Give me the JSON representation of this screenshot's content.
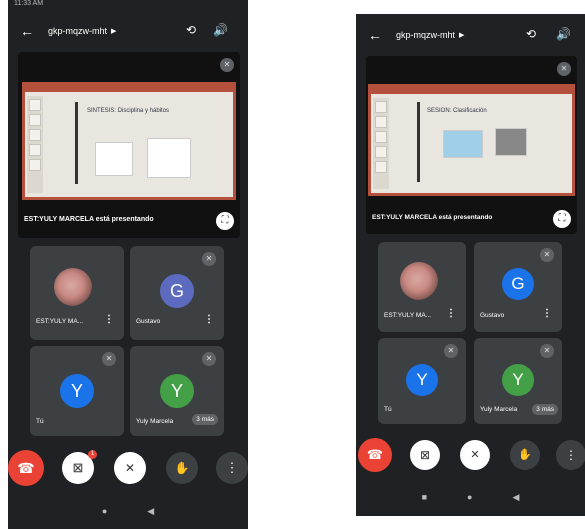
{
  "left": {
    "status_time": "11:33 AM",
    "meeting_code": "gkp-mqzw-mht",
    "slide_title": "SINTESIS: Disciplina y hábitos",
    "presenter_caption": "EST:YULY MARCELA está presentando",
    "participants": [
      {
        "name": "EST:YULY MA...",
        "initial": "",
        "color": ""
      },
      {
        "name": "Gustavo",
        "initial": "G",
        "color": "#5c6bc0"
      },
      {
        "name": "Tú",
        "initial": "Y",
        "color": "#1a73e8"
      },
      {
        "name": "Yuly Marcela",
        "initial": "Y",
        "color": "#43a047"
      }
    ],
    "more_label": "3 más",
    "camera_badge": "1"
  },
  "right": {
    "meeting_code": "gkp-mqzw-mht",
    "slide_title": "SESION: Clasificación",
    "presenter_caption": "EST:YULY MARCELA está presentando",
    "participants": [
      {
        "name": "EST:YULY MA...",
        "initial": "",
        "color": ""
      },
      {
        "name": "Gustavo",
        "initial": "G",
        "color": "#1a73e8"
      },
      {
        "name": "Tú",
        "initial": "Y",
        "color": "#1a73e8"
      },
      {
        "name": "Yuly Marcela",
        "initial": "Y",
        "color": "#43a047"
      }
    ],
    "more_label": "3 más"
  },
  "icons": {
    "back": "←",
    "switch_camera": "⟲",
    "speaker": "🔊",
    "mic_off": "✕",
    "fullscreen": "⛶",
    "more_vert": "⋮",
    "hangup": "☎",
    "camera_off": "⊠",
    "mic_off_ctrl": "✕",
    "raise_hand": "✋",
    "nav_home": "●",
    "nav_back": "◀",
    "nav_square": "■"
  }
}
